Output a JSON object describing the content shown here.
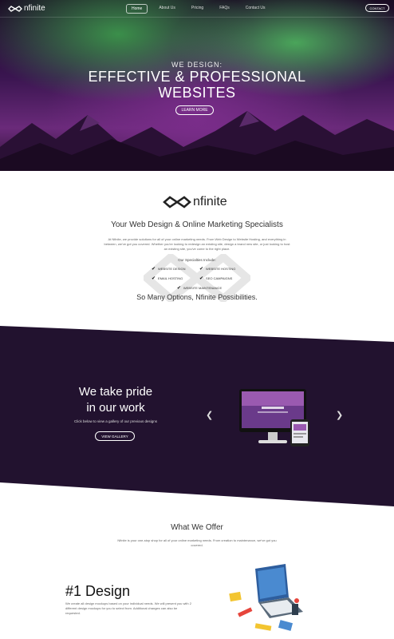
{
  "nav": {
    "logo": "nfinite",
    "links": [
      "Home",
      "About Us",
      "Pricing",
      "FAQs",
      "Contact Us"
    ],
    "contact_button": "CONTACT"
  },
  "hero": {
    "pre_title": "WE DESIGN:",
    "title_line1": "EFFECTIVE & PROFESSIONAL",
    "title_line2": "WEBSITES",
    "button": "LEARN MORE"
  },
  "intro": {
    "logo": "nfinite",
    "heading": "Your Web Design & Online Marketing Specialists",
    "body": "At Nfinite, we provide solutions for all of your online marketing needs. From Web Design to Website Hosting, and everything in between, we've got you covered. Whether you're looking to redesign an existing site, design a brand new site, or just looking to host an existing site, you've come to the right place.",
    "specialties_title": "Our Specialties Include:",
    "specialties": [
      "WEBSITE DESIGN",
      "WEBSITE HOSTING",
      "EMAIL HOSTING",
      "SEO CAMPAIGNS",
      "WEBSITE MAINTENANCE"
    ],
    "tagline": "So Many Options, Nfinite Possibilities."
  },
  "portfolio": {
    "title_line1": "We take pride",
    "title_line2": "in our work",
    "subtitle": "Click below to view a gallery of our previous designs",
    "button": "VIEW GALLERY"
  },
  "offer": {
    "title": "What We Offer",
    "body": "Nfinite is your one-stop shop for all of your online marketing needs. From creation to maintenance, we've got you covered."
  },
  "design": {
    "title": "#1 Design",
    "body": "We create all design mockups based on your individual needs. We will present you with 2 different design mockups for you to select from. Additional changes can also be requested."
  },
  "icons": {
    "logo": "infinity-logo-icon",
    "check": "checkmark-icon",
    "prev": "chevron-left-icon",
    "next": "chevron-right-icon"
  },
  "colors": {
    "dark_purple": "#22122f",
    "aurora_green": "#4aa55a",
    "aurora_purple": "#7a2d8a"
  }
}
